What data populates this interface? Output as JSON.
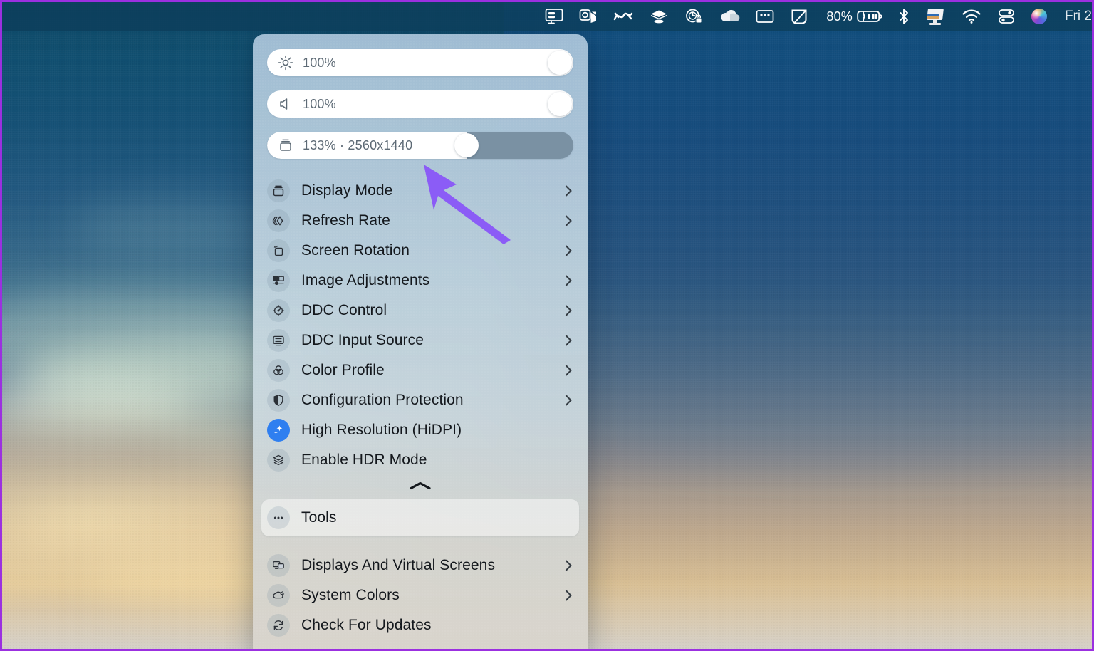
{
  "menubar": {
    "icons": [
      {
        "name": "screen-sharing-icon",
        "glyph": "display"
      },
      {
        "name": "outlook-icon",
        "glyph": "outlook"
      },
      {
        "name": "stats-icon",
        "glyph": "stats"
      },
      {
        "name": "dropbox-icon",
        "glyph": "dropbox"
      },
      {
        "name": "time-lock-icon",
        "glyph": "timelock"
      },
      {
        "name": "onedrive-cloud-icon",
        "glyph": "cloud"
      },
      {
        "name": "window-tiling-icon",
        "glyph": "window"
      },
      {
        "name": "shape-icon",
        "glyph": "shape"
      }
    ],
    "battery_percent": "80%",
    "battery_name": "battery-charging-icon",
    "right_icons": [
      {
        "name": "bluetooth-icon",
        "glyph": "bluetooth"
      },
      {
        "name": "betterdisplay-app-icon",
        "glyph": "appicon"
      },
      {
        "name": "wifi-icon",
        "glyph": "wifi"
      },
      {
        "name": "control-center-icon",
        "glyph": "controlcenter"
      },
      {
        "name": "siri-icon",
        "glyph": "siri"
      }
    ],
    "clock": "Fri 2"
  },
  "panel": {
    "sliders": [
      {
        "icon": "brightness-icon",
        "label": "100%",
        "fill_percent": 100,
        "style": "full"
      },
      {
        "icon": "volume-icon",
        "label": "100%",
        "fill_percent": 100,
        "style": "full"
      },
      {
        "icon": "resolution-icon",
        "label": "133% · 2560x1440",
        "fill_percent": 65,
        "style": "partial"
      }
    ],
    "items": [
      {
        "icon": "display-mode-icon",
        "label": "Display Mode",
        "chevron": true,
        "accent": false
      },
      {
        "icon": "refresh-rate-icon",
        "label": "Refresh Rate",
        "chevron": true,
        "accent": false
      },
      {
        "icon": "screen-rotation-icon",
        "label": "Screen Rotation",
        "chevron": true,
        "accent": false
      },
      {
        "icon": "image-adjustments-icon",
        "label": "Image Adjustments",
        "chevron": true,
        "accent": false
      },
      {
        "icon": "ddc-control-icon",
        "label": "DDC Control",
        "chevron": true,
        "accent": false
      },
      {
        "icon": "ddc-input-source-icon",
        "label": "DDC Input Source",
        "chevron": true,
        "accent": false
      },
      {
        "icon": "color-profile-icon",
        "label": "Color Profile",
        "chevron": true,
        "accent": false
      },
      {
        "icon": "configuration-protection-icon",
        "label": "Configuration Protection",
        "chevron": true,
        "accent": false
      },
      {
        "icon": "high-resolution-icon",
        "label": "High Resolution (HiDPI)",
        "chevron": false,
        "accent": true
      },
      {
        "icon": "hdr-mode-icon",
        "label": "Enable HDR Mode",
        "chevron": false,
        "accent": false
      }
    ],
    "collapse_icon": "chevron-up-icon",
    "tools": {
      "icon": "ellipsis-icon",
      "label": "Tools"
    },
    "footer_items": [
      {
        "icon": "displays-virtual-screens-icon",
        "label": "Displays And Virtual Screens",
        "chevron": true
      },
      {
        "icon": "system-colors-icon",
        "label": "System Colors",
        "chevron": true
      },
      {
        "icon": "check-updates-icon",
        "label": "Check For Updates",
        "chevron": false
      }
    ]
  },
  "annotation": {
    "arrow_name": "annotation-arrow",
    "arrow_color": "#8b5cf6"
  },
  "colors": {
    "accent_blue": "#2f7ff0",
    "menubar_bg": "#0c3e5c",
    "frame_border": "#9b30e0"
  }
}
